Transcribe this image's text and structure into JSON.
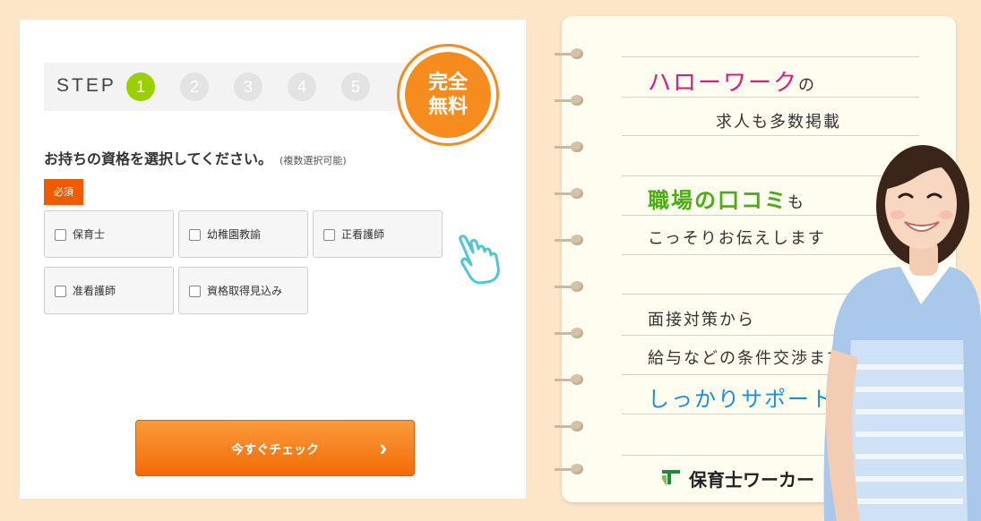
{
  "form": {
    "step_label": "STEP",
    "steps": [
      "1",
      "2",
      "3",
      "4",
      "5"
    ],
    "active_step": 1,
    "badge": {
      "line1": "完全",
      "line2": "無料"
    },
    "question": "お持ちの資格を選択してください。",
    "question_note": "(複数選択可能)",
    "required_label": "必須",
    "options": [
      "保育士",
      "幼稚園教諭",
      "正看護師",
      "准看護師",
      "資格取得見込み"
    ],
    "submit_label": "今すぐチェック",
    "submit_icon": "chevron-right-icon"
  },
  "notepad": {
    "line1_a": "ハローワーク",
    "line1_b": "の",
    "line2": "求人も多数掲載",
    "line3_a": "職場の口コミ",
    "line3_b": "も",
    "line4": "こっそりお伝えします",
    "line5": "面接対策から",
    "line6": "給与などの条件交渉まで",
    "line7": "しっかりサポート",
    "brand": "保育士ワーカー"
  },
  "colors": {
    "background": "#fde6c8",
    "accent_orange": "#f68c1e",
    "step_active": "#9bd000",
    "required": "#f05a00",
    "pink": "#e0197d",
    "green": "#4aad12",
    "blue": "#1a8fd6"
  }
}
